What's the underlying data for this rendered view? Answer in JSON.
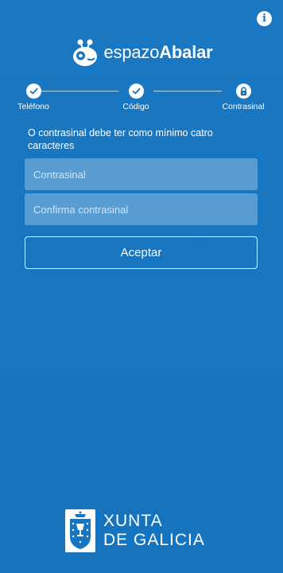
{
  "header": {
    "info_icon": "info-icon",
    "info_glyph": "i"
  },
  "logo": {
    "mark_icon": "bee-mascot-icon",
    "text_light": "espazo",
    "text_bold": "Abalar"
  },
  "stepper": {
    "steps": [
      {
        "label": "Teléfono",
        "icon": "check-icon",
        "state": "done"
      },
      {
        "label": "Código",
        "icon": "check-icon",
        "state": "done"
      },
      {
        "label": "Contrasinal",
        "icon": "lock-icon",
        "state": "current"
      }
    ]
  },
  "form": {
    "hint": "O contrasinal debe ter como mínimo catro caracteres",
    "password": {
      "value": "",
      "placeholder": "Contrasinal"
    },
    "confirm": {
      "value": "",
      "placeholder": "Confirma contrasinal"
    },
    "submit_label": "Aceptar"
  },
  "footer": {
    "emblem_icon": "xunta-emblem-icon",
    "line1": "XUNTA",
    "line2": "DE GALICIA"
  },
  "colors": {
    "background": "#1876c0",
    "accent": "#ffffff"
  }
}
